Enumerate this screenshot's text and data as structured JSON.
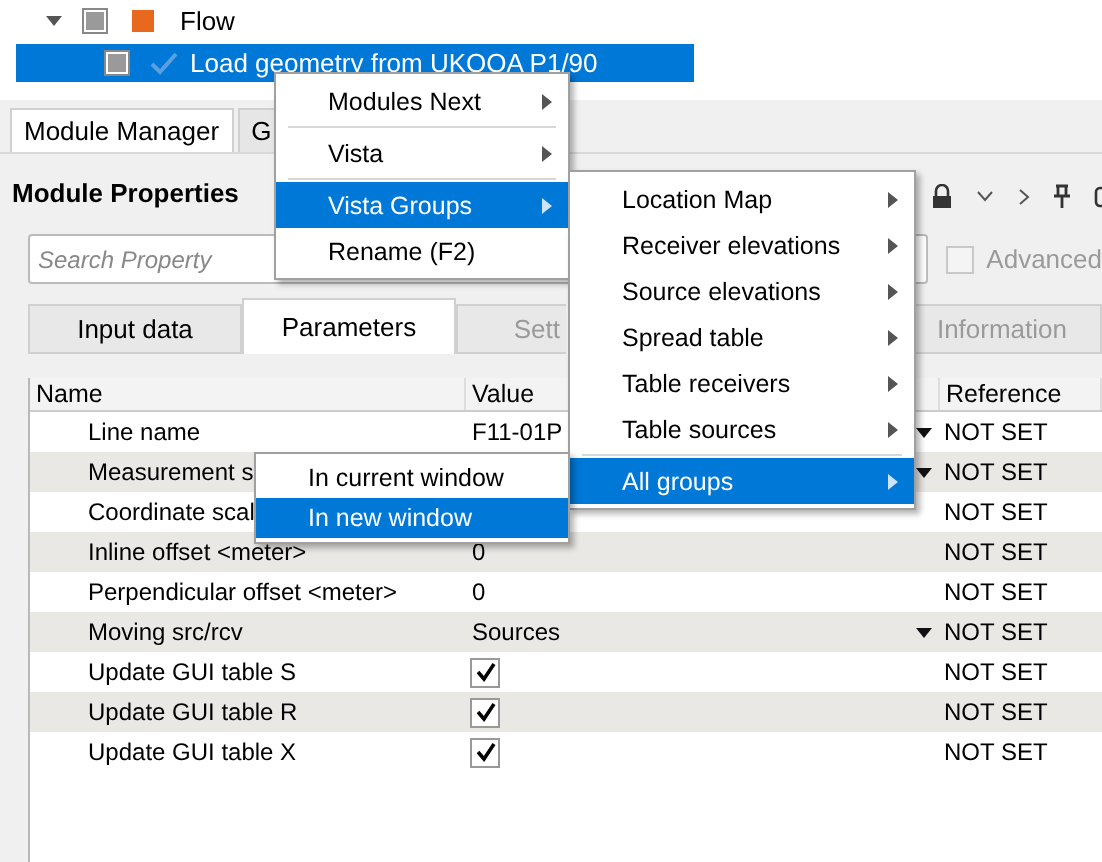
{
  "tree": [
    {
      "label": "Flow",
      "expanded": true,
      "selected": false,
      "children": [
        {
          "label": "Load geometry from UKOOA P1/90",
          "selected": true
        }
      ]
    }
  ],
  "dock_tabs": [
    {
      "label": "Module Manager",
      "selected": true
    },
    {
      "label": "G",
      "selected": false
    }
  ],
  "panel": {
    "title": "Module Properties",
    "search": {
      "placeholder": "Search Property"
    },
    "advanced": {
      "label": "Advanced",
      "checked": false,
      "disabled": true
    }
  },
  "tabs": [
    {
      "label": "Input data",
      "selected": false
    },
    {
      "label": "Parameters",
      "selected": true
    },
    {
      "label": "Sett",
      "selected": false
    },
    {
      "label": "Information",
      "selected": false
    }
  ],
  "table": {
    "columns": [
      "Name",
      "Value",
      "Reference"
    ],
    "rows": [
      {
        "name": "Line name",
        "kind": "combo",
        "value": "F11-01P",
        "reference": "NOT SET"
      },
      {
        "name": "Measurement s",
        "kind": "combo",
        "reference": "NOT SET"
      },
      {
        "name": "Coordinate scal",
        "kind": "text",
        "reference": "NOT SET"
      },
      {
        "name": "Inline offset <meter>",
        "kind": "text",
        "value": "0",
        "reference": "NOT SET"
      },
      {
        "name": "Perpendicular offset <meter>",
        "kind": "text",
        "value": "0",
        "reference": "NOT SET"
      },
      {
        "name": "Moving src/rcv",
        "kind": "combo",
        "value": "Sources",
        "reference": "NOT SET"
      },
      {
        "name": "Update GUI table S",
        "kind": "check",
        "checked": true,
        "reference": "NOT SET"
      },
      {
        "name": "Update GUI table R",
        "kind": "check",
        "checked": true,
        "reference": "NOT SET"
      },
      {
        "name": "Update GUI table X",
        "kind": "check",
        "checked": true,
        "reference": "NOT SET"
      }
    ]
  },
  "context_menu": {
    "items": [
      {
        "kind": "item",
        "label": "Modules Next",
        "submenu": true,
        "selected": false
      },
      {
        "kind": "separator"
      },
      {
        "kind": "item",
        "label": "Vista",
        "submenu": true,
        "selected": false
      },
      {
        "kind": "separator"
      },
      {
        "kind": "item",
        "label": "Vista Groups",
        "submenu": true,
        "selected": true
      },
      {
        "kind": "item",
        "label": "Rename (F2)",
        "submenu": false,
        "selected": false
      }
    ]
  },
  "vista_groups_menu": {
    "items": [
      {
        "kind": "item",
        "label": "Location Map",
        "submenu": true,
        "selected": false
      },
      {
        "kind": "item",
        "label": "Receiver elevations",
        "submenu": true,
        "selected": false
      },
      {
        "kind": "item",
        "label": "Source elevations",
        "submenu": true,
        "selected": false
      },
      {
        "kind": "item",
        "label": "Spread table",
        "submenu": true,
        "selected": false
      },
      {
        "kind": "item",
        "label": "Table receivers",
        "submenu": true,
        "selected": false
      },
      {
        "kind": "item",
        "label": "Table sources",
        "submenu": true,
        "selected": false
      },
      {
        "kind": "separator"
      },
      {
        "kind": "item",
        "label": "All groups",
        "submenu": true,
        "selected": true
      }
    ]
  },
  "all_groups_menu": {
    "items": [
      {
        "kind": "item",
        "label": "In current window",
        "submenu": false,
        "selected": false
      },
      {
        "kind": "item",
        "label": "In new window",
        "submenu": false,
        "selected": true
      }
    ]
  }
}
